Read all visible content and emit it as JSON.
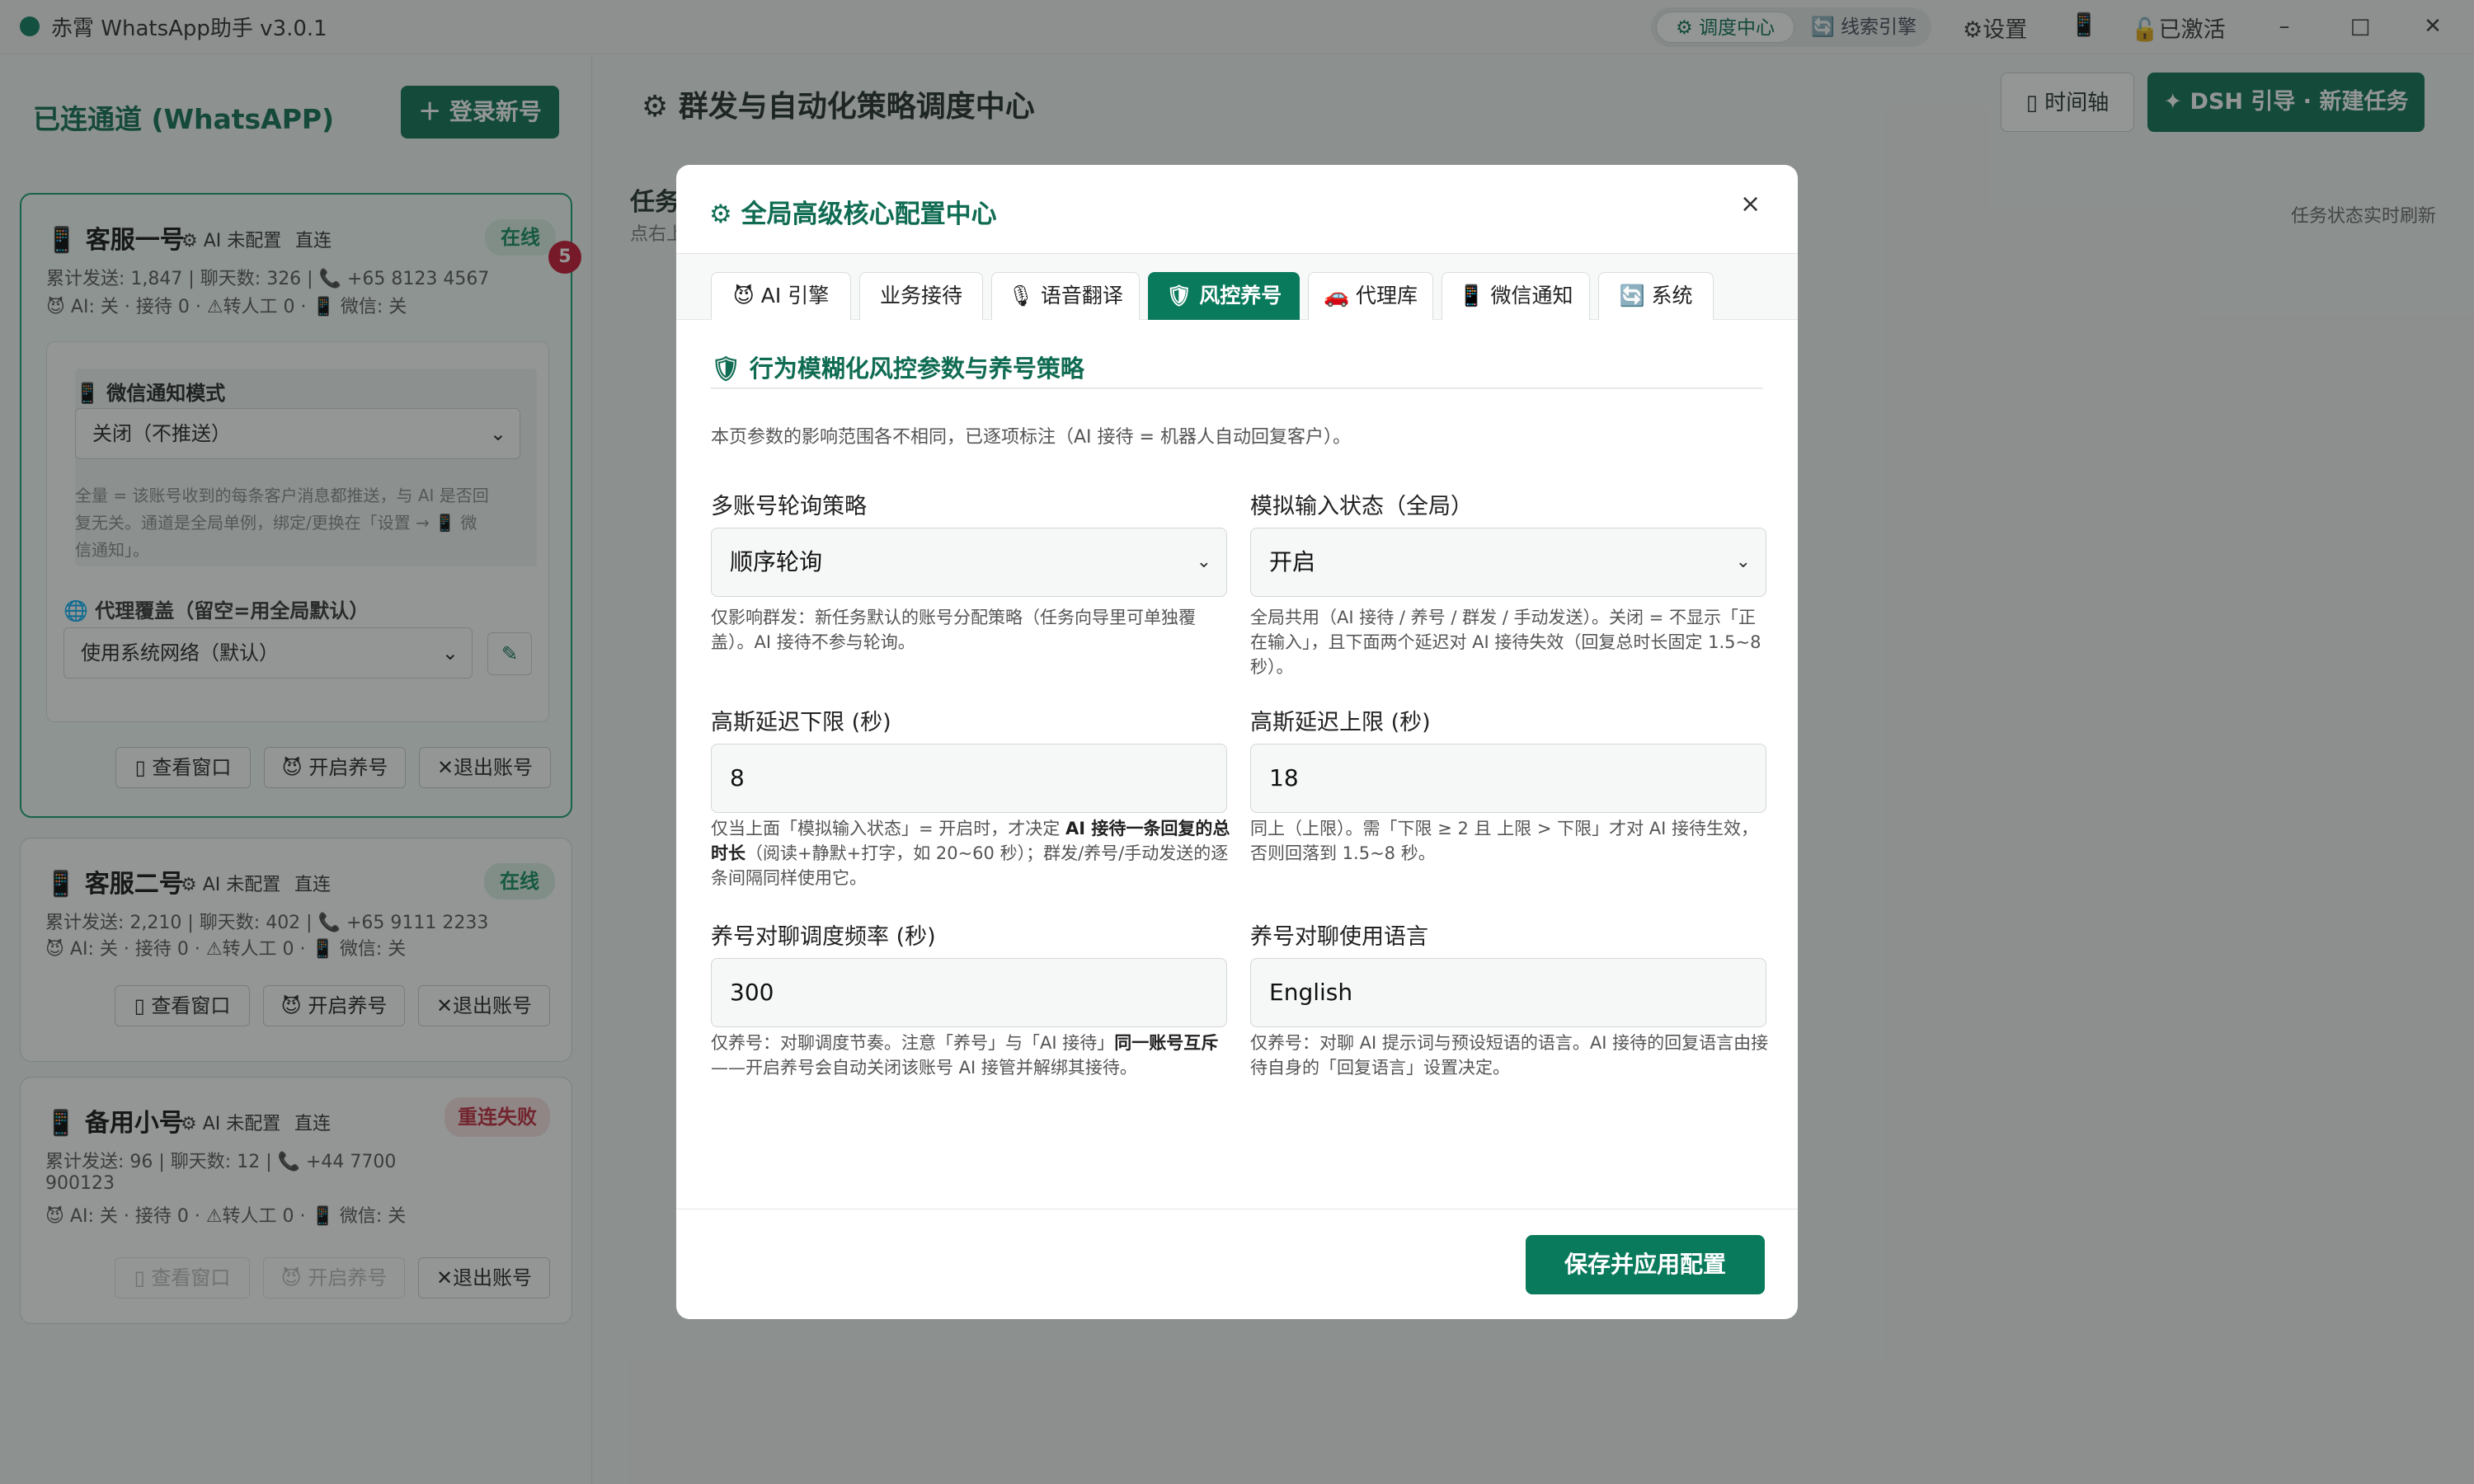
{
  "titlebar": {
    "app_title": "赤霄 WhatsApp助手 v3.0.1",
    "seg_dispatch": "⚙ 调度中心",
    "seg_leads": "线索引擎",
    "settings": "⚙设置",
    "phone_icon": "📱",
    "activated": "已激活",
    "min": "–",
    "max": "□",
    "close": "✕"
  },
  "left": {
    "title": "已连通道 (WhatsAPP)",
    "login_btn": "＋ 登录新号",
    "badge_count": "5"
  },
  "cards": [
    {
      "name": "客服一号",
      "ai": "⚙ AI 未配置",
      "route": "直连",
      "status": "在线",
      "stats": "累计发送: 1,847 | 聊天数: 326 | 📞 +65 8123 4567",
      "line2": "😈 AI: 关 · 接待 0 · ⚠转人工 0 · 📱 微信: 关",
      "btn_view": "查看窗口",
      "btn_nurture": "开启养号",
      "btn_logout": "退出账号"
    },
    {
      "name": "客服二号",
      "ai": "⚙ AI 未配置",
      "route": "直连",
      "status": "在线",
      "stats": "累计发送: 2,210 | 聊天数: 402 | 📞 +65 9111 2233",
      "line2": "😈 AI: 关 · 接待 0 · ⚠转人工 0 · 📱 微信: 关",
      "btn_view": "查看窗口",
      "btn_nurture": "开启养号",
      "btn_logout": "退出账号"
    },
    {
      "name": "备用小号",
      "ai": "⚙ AI 未配置",
      "route": "直连",
      "status": "重连失败",
      "stats": "累计发送: 96 | 聊天数: 12 | 📞 +44 7700",
      "stats2": "900123",
      "line2": "😈 AI: 关 · 接待 0 · ⚠转人工 0 · 📱 微信: 关",
      "btn_view": "查看窗口",
      "btn_nurture": "开启养号",
      "btn_logout": "退出账号"
    }
  ],
  "card1_panel": {
    "wechat_label": "📱 微信通知模式",
    "wechat_value": "关闭（不推送）",
    "desc_1": "全量 = 该账号收到的每条客户消息都推送，与 AI 是否回",
    "desc_2": "复无关。通道是全局单例，绑定/更换在「设置 → 📱 微",
    "desc_3": "信通知」。",
    "proxy_label": "🌐 代理覆盖（留空=用全局默认）",
    "proxy_value": "使用系统网络（默认）"
  },
  "main": {
    "title": "⚙ 群发与自动化策略调度中心",
    "timeline_btn": "▯ 时间轴",
    "dsh_btn": "✦ DSH 引导 · 新建任务",
    "task_heading": "任务",
    "task_sub": "点右上",
    "live": "任务状态实时刷新"
  },
  "modal": {
    "title": "⚙ 全局高级核心配置中心",
    "close": "×",
    "tabs": [
      "😈 AI 引擎",
      "业务接待",
      "🎙 语音翻译",
      "🛡 风控养号",
      "🚗 代理库",
      "📱 微信通知",
      "🔄 系统"
    ],
    "section_title": "🛡 行为模糊化风控参数与养号策略",
    "section_desc": "本页参数的影响范围各不相同，已逐项标注（AI 接待 = 机器人自动回复客户）。",
    "fields": {
      "rotation": {
        "label": "多账号轮询策略",
        "value": "顺序轮询",
        "hint": "仅影响群发：新任务默认的账号分配策略（任务向导里可单独覆盖）。AI 接待不参与轮询。"
      },
      "typing": {
        "label": "模拟输入状态（全局）",
        "value": "开启",
        "hint": "全局共用（AI 接待 / 养号 / 群发 / 手动发送）。关闭 = 不显示「正在输入」，且下面两个延迟对 AI 接待失效（回复总时长固定 1.5~8 秒）。"
      },
      "delay_min": {
        "label": "高斯延迟下限 (秒)",
        "value": "8",
        "hint_a": "仅当上面「模拟输入状态」= 开启时，才决定 ",
        "hint_b": "AI 接待一条回复的总时长",
        "hint_c": "（阅读+静默+打字，如 20~60 秒）；群发/养号/手动发送的逐条间隔同样使用它。"
      },
      "delay_max": {
        "label": "高斯延迟上限 (秒)",
        "value": "18",
        "hint": "同上（上限）。需「下限 ≥ 2 且 上限 > 下限」才对 AI 接待生效，否则回落到 1.5~8 秒。"
      },
      "freq": {
        "label": "养号对聊调度频率 (秒)",
        "value": "300",
        "hint_a": "仅养号：对聊调度节奏。注意「养号」与「AI 接待」",
        "hint_b": "同一账号互斥",
        "hint_c": "——开启养号会自动关闭该账号 AI 接管并解绑其接待。"
      },
      "lang": {
        "label": "养号对聊使用语言",
        "value": "English",
        "hint": "仅养号：对聊 AI 提示词与预设短语的语言。AI 接待的回复语言由接待自身的「回复语言」设置决定。"
      }
    },
    "save_btn": "保存并应用配置"
  }
}
